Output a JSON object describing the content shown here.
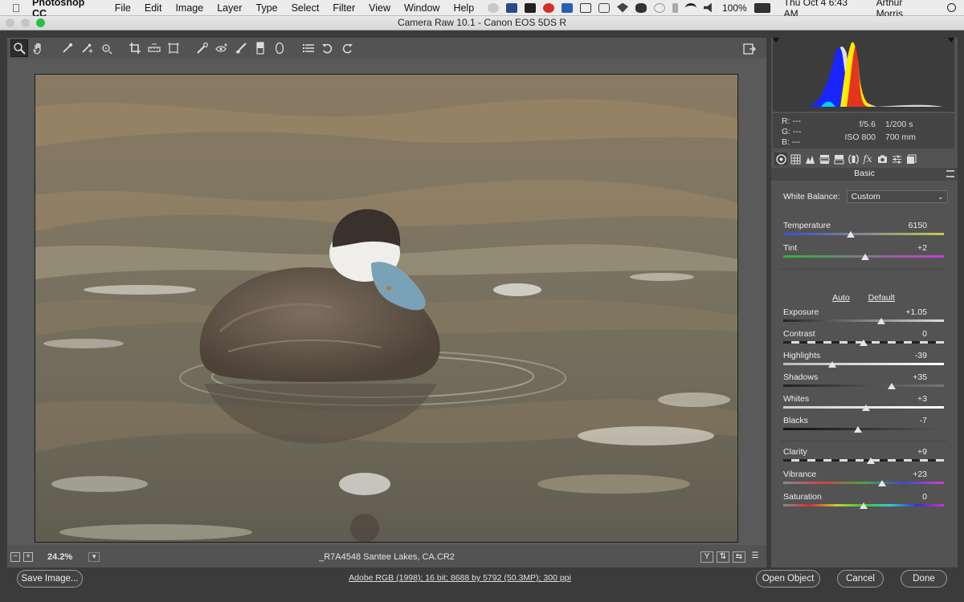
{
  "menubar": {
    "app_name": "Photoshop CC",
    "items": [
      "File",
      "Edit",
      "Image",
      "Layer",
      "Type",
      "Select",
      "Filter",
      "View",
      "Window",
      "Help"
    ],
    "battery": "100%",
    "clock": "Thu Oct 4  6:43 AM",
    "user": "Arthur Morris"
  },
  "window": {
    "title": "Camera Raw 10.1  -  Canon EOS 5DS R"
  },
  "toolbar": {
    "tools": [
      "zoom-tool",
      "hand-tool",
      "white-balance-tool",
      "color-sampler-tool",
      "targeted-adjustment-tool",
      "crop-tool",
      "straighten-tool",
      "transform-tool",
      "spot-removal-tool",
      "red-eye-tool",
      "adjustment-brush-tool",
      "graduated-filter-tool",
      "radial-filter-tool",
      "preferences-tool",
      "rotate-ccw-tool",
      "rotate-cw-tool"
    ]
  },
  "statusbar": {
    "zoom": "24.2%",
    "filename": "_R7A4548  Santee Lakes, CA.CR2"
  },
  "histogram": {
    "r_label": "R:",
    "g_label": "G:",
    "b_label": "B:",
    "r_value": "---",
    "g_value": "---",
    "b_value": "---",
    "aperture": "f/5.6",
    "shutter": "1/200 s",
    "iso": "ISO 800",
    "focal": "700 mm"
  },
  "panel": {
    "title": "Basic",
    "white_balance_label": "White Balance:",
    "white_balance_value": "Custom",
    "auto_label": "Auto",
    "default_label": "Default",
    "sliders": [
      {
        "label": "Temperature",
        "value": "6150",
        "pos": 0.42
      },
      {
        "label": "Tint",
        "value": "+2",
        "pos": 0.51
      },
      {
        "label": "Exposure",
        "value": "+1.05",
        "pos": 0.61
      },
      {
        "label": "Contrast",
        "value": "0",
        "pos": 0.5
      },
      {
        "label": "Highlights",
        "value": "-39",
        "pos": 0.305
      },
      {
        "label": "Shadows",
        "value": "+35",
        "pos": 0.675
      },
      {
        "label": "Whites",
        "value": "+3",
        "pos": 0.515
      },
      {
        "label": "Blacks",
        "value": "-7",
        "pos": 0.465
      },
      {
        "label": "Clarity",
        "value": "+9",
        "pos": 0.545
      },
      {
        "label": "Vibrance",
        "value": "+23",
        "pos": 0.615
      },
      {
        "label": "Saturation",
        "value": "0",
        "pos": 0.5
      }
    ]
  },
  "bottombar": {
    "save_label": "Save Image...",
    "workflow_text": "Adobe RGB (1998); 16 bit; 8688 by 5792 (50.3MP); 300 ppi",
    "open_label": "Open Object",
    "cancel_label": "Cancel",
    "done_label": "Done"
  }
}
